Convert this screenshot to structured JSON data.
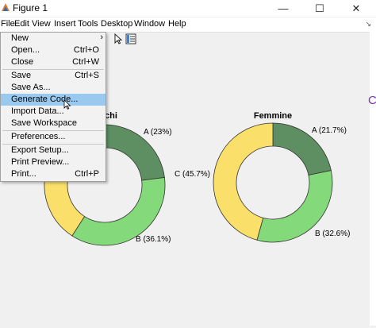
{
  "window": {
    "title": "Figure 1",
    "controls": {
      "minimize": "—",
      "maximize": "☐",
      "close": "✕"
    }
  },
  "menubar": {
    "items": [
      "File",
      "Edit",
      "View",
      "Insert",
      "Tools",
      "Desktop",
      "Window",
      "Help"
    ]
  },
  "file_menu": {
    "items": [
      {
        "label": "New",
        "shortcut": "",
        "has_submenu": true
      },
      {
        "label": "Open...",
        "shortcut": "Ctrl+O"
      },
      {
        "label": "Close",
        "shortcut": "Ctrl+W"
      },
      {
        "label": "Save",
        "shortcut": "Ctrl+S"
      },
      {
        "label": "Save As...",
        "shortcut": ""
      },
      {
        "label": "Generate Code...",
        "shortcut": "",
        "highlighted": true
      },
      {
        "label": "Import Data...",
        "shortcut": ""
      },
      {
        "label": "Save Workspace",
        "shortcut": ""
      },
      {
        "label": "Preferences...",
        "shortcut": ""
      },
      {
        "label": "Export Setup...",
        "shortcut": ""
      },
      {
        "label": "Print Preview...",
        "shortcut": ""
      },
      {
        "label": "Print...",
        "shortcut": "Ctrl+P"
      }
    ]
  },
  "right_edge_glyph": "C",
  "colors": {
    "A": "#5e8f62",
    "B": "#84d97a",
    "C": "#fadf6b",
    "highlight": "#99c9ef"
  },
  "chart_data": [
    {
      "type": "pie",
      "variant": "donut",
      "title": "chi",
      "slices": [
        {
          "category": "A",
          "label": "A (23%)",
          "value": 23.0
        },
        {
          "category": "B",
          "label": "B (36.1%)",
          "value": 36.1
        },
        {
          "category": "C",
          "label": "",
          "value": 40.9
        }
      ]
    },
    {
      "type": "pie",
      "variant": "donut",
      "title": "Femmine",
      "slices": [
        {
          "category": "A",
          "label": "A (21.7%)",
          "value": 21.7
        },
        {
          "category": "B",
          "label": "B (32.6%)",
          "value": 32.6
        },
        {
          "category": "C",
          "label": "C (45.7%)",
          "value": 45.7
        }
      ]
    }
  ]
}
